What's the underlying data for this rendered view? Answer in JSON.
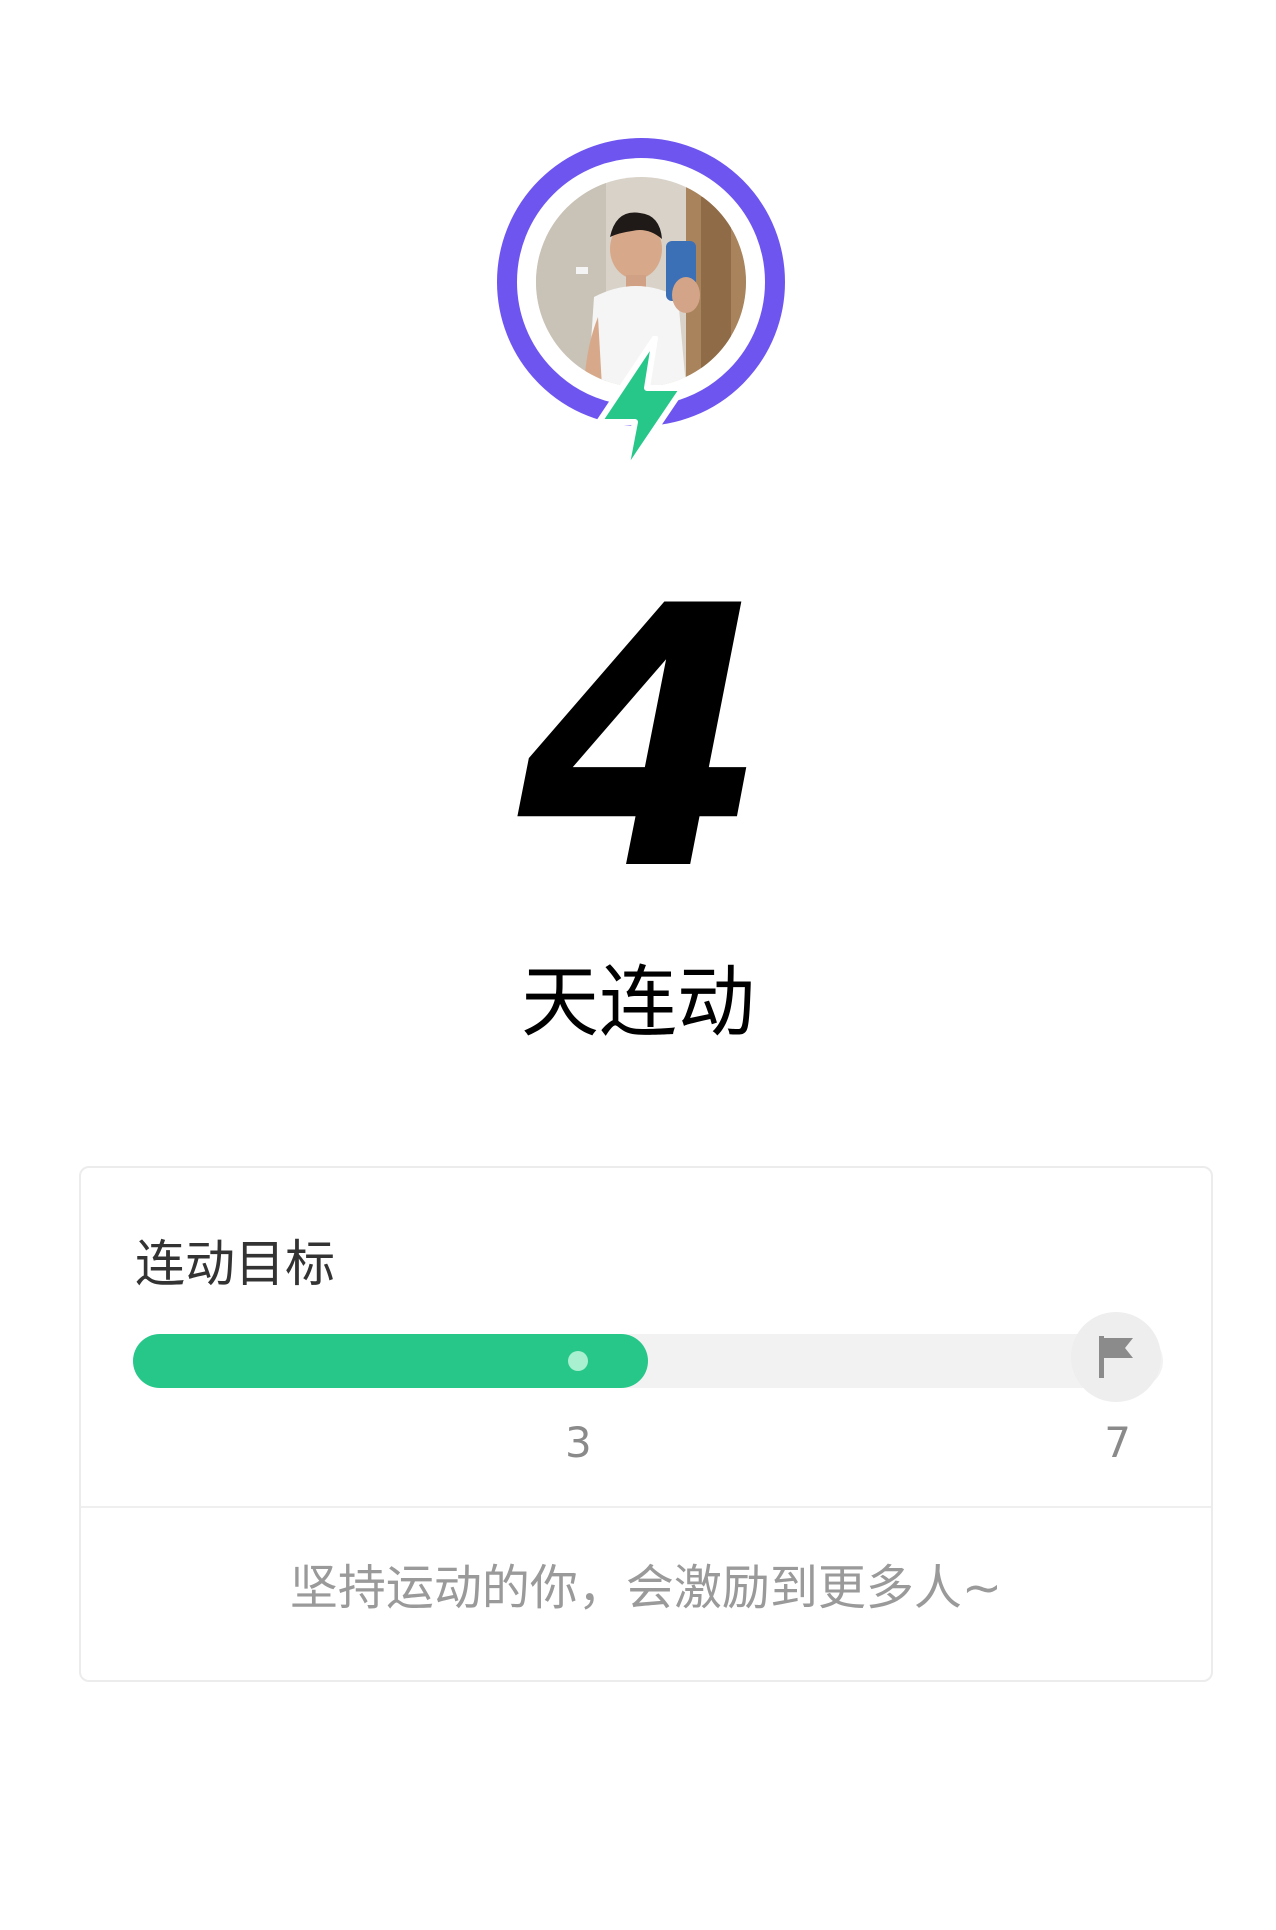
{
  "profile": {
    "avatar_alt": "user avatar",
    "ring_color": "#6e55f0",
    "badge_color": "#27c78a",
    "badge_icon": "lightning-bolt-icon"
  },
  "streak": {
    "days": "4",
    "label": "天连动"
  },
  "goal": {
    "title": "连动目标",
    "current": 3,
    "target": 7,
    "current_label": "3",
    "target_label": "7",
    "progress_fraction": 0.5,
    "fill_color": "#27c78a",
    "flag_icon": "flag-icon",
    "motto": "坚持运动的你，会激励到更多人~"
  }
}
